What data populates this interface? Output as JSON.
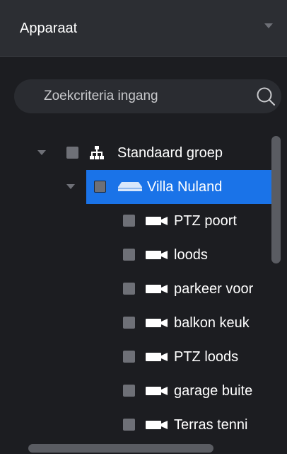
{
  "header": {
    "title": "Apparaat"
  },
  "search": {
    "placeholder": "Zoekcriteria ingang"
  },
  "tree": {
    "group": {
      "label": "Standaard groep"
    },
    "device": {
      "label": "Villa Nuland",
      "selected": true
    },
    "channels": [
      {
        "label": "PTZ poort"
      },
      {
        "label": "loods"
      },
      {
        "label": "parkeer voor"
      },
      {
        "label": "balkon keuk"
      },
      {
        "label": "PTZ loods"
      },
      {
        "label": "garage buite"
      },
      {
        "label": "Terras tenni"
      }
    ]
  },
  "colors": {
    "accent": "#1a73e8",
    "background": "#1c1d21",
    "header": "#2c2e33"
  }
}
